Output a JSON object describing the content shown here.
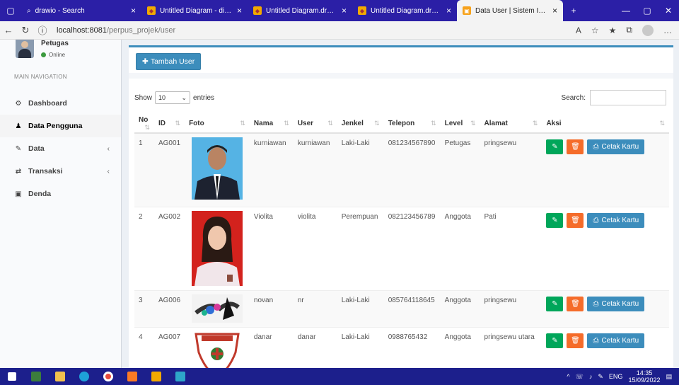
{
  "browser": {
    "tabs": [
      {
        "title": "drawio - Search",
        "active": false
      },
      {
        "title": "Untitled Diagram - diagrams",
        "active": false
      },
      {
        "title": "Untitled Diagram.drawio - d",
        "active": false
      },
      {
        "title": "Untitled Diagram.drawio - d",
        "active": false
      },
      {
        "title": "Data User | Sistem Informasi",
        "active": true
      }
    ],
    "url_host": "localhost:8081",
    "url_path": "/perpus_projek/user"
  },
  "sidebar": {
    "user_name": "Petugas",
    "user_status": "Online",
    "nav_header": "MAIN NAVIGATION",
    "items": [
      {
        "label": "Dashboard",
        "icon": "dashboard-icon",
        "glyph": "⚙",
        "has_chevron": false
      },
      {
        "label": "Data Pengguna",
        "icon": "user-icon",
        "glyph": "♟",
        "has_chevron": false
      },
      {
        "label": "Data",
        "icon": "edit-icon",
        "glyph": "✎",
        "has_chevron": true
      },
      {
        "label": "Transaksi",
        "icon": "exchange-icon",
        "glyph": "⇄",
        "has_chevron": true
      },
      {
        "label": "Denda",
        "icon": "money-icon",
        "glyph": "▣",
        "has_chevron": false
      }
    ]
  },
  "toolbar": {
    "add_label": "Tambah User"
  },
  "table_controls": {
    "show_label": "Show",
    "entries_value": "10",
    "entries_label": "entries",
    "search_label": "Search:"
  },
  "table": {
    "columns": [
      "No",
      "ID",
      "Foto",
      "Nama",
      "User",
      "Jenkel",
      "Telepon",
      "Level",
      "Alamat",
      "Aksi"
    ],
    "rows": [
      {
        "no": "1",
        "id": "AG001",
        "nama": "kurniawan",
        "user": "kurniawan",
        "jenkel": "Laki-Laki",
        "telepon": "081234567890",
        "level": "Petugas",
        "alamat": "pringsewu",
        "photo": "portrait-blue"
      },
      {
        "no": "2",
        "id": "AG002",
        "nama": "Violita",
        "user": "violita",
        "jenkel": "Perempuan",
        "telepon": "082123456789",
        "level": "Anggota",
        "alamat": "Pati",
        "photo": "portrait-red"
      },
      {
        "no": "3",
        "id": "AG006",
        "nama": "novan",
        "user": "nr",
        "jenkel": "Laki-Laki",
        "telepon": "085764118645",
        "level": "Anggota",
        "alamat": "pringsewu",
        "photo": "splash-art"
      },
      {
        "no": "4",
        "id": "AG007",
        "nama": "danar",
        "user": "danar",
        "jenkel": "Laki-Laki",
        "telepon": "0988765432",
        "level": "Anggota",
        "alamat": "pringsewu utara",
        "photo": "school-logo"
      }
    ],
    "print_label": "Cetak Kartu"
  },
  "colors": {
    "primary": "#3c8dbc",
    "success": "#00a65a",
    "danger": "#f56c2a",
    "taskbar": "#1c1f8c",
    "tabstrip": "#2b1fa6"
  },
  "taskbar": {
    "lang": "ENG",
    "time": "14:35",
    "date": "15/09/2022"
  }
}
